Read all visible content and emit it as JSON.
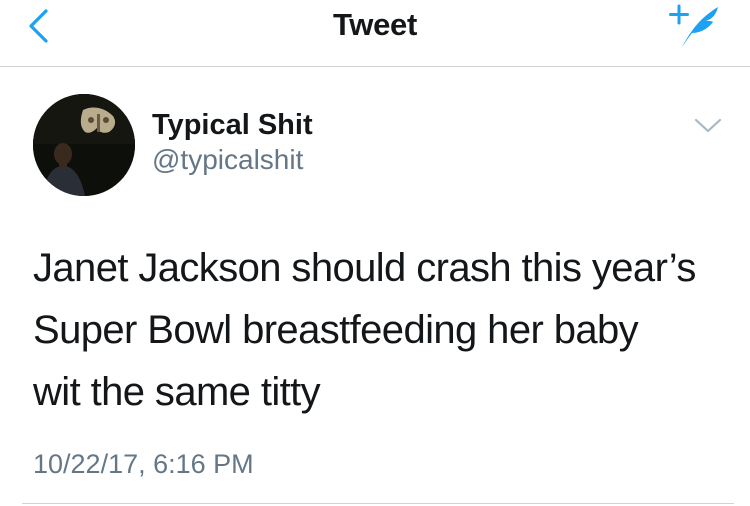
{
  "navbar": {
    "title": "Tweet",
    "back_icon": "chevron-left-icon",
    "compose_icon": "compose-tweet-icon"
  },
  "tweet": {
    "author": {
      "display_name": "Typical Shit",
      "handle": "@typicalshit"
    },
    "text": "Janet Jackson should crash this year’s\nSuper Bowl breastfeeding her baby\nwit the same titty",
    "timestamp": "10/22/17, 6:16 PM",
    "more_icon": "chevron-down-icon"
  },
  "colors": {
    "accent": "#1da1f2",
    "text_primary": "#14171a",
    "text_secondary": "#657786",
    "divider": "#cfd4d9"
  }
}
